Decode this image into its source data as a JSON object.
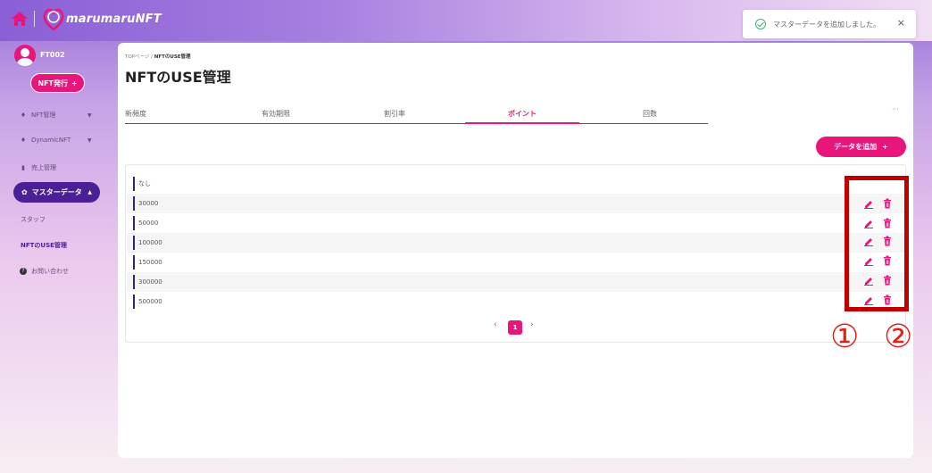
{
  "app": {
    "logo_text": "marumaruNFT"
  },
  "toast": {
    "message": "マスターデータを追加しました。",
    "close": "×"
  },
  "user": {
    "name": "FT002"
  },
  "sidebar": {
    "issue_button": "NFT発行",
    "issue_plus": "+",
    "items": [
      {
        "label": "NFT管理",
        "icon": "♦",
        "chevron": "▼"
      },
      {
        "label": "DynamicNFT",
        "icon": "♦",
        "chevron": "▼"
      },
      {
        "label": "売上管理",
        "icon": "▮"
      },
      {
        "label": "マスターデータ",
        "icon": "✿",
        "chevron": "▲"
      },
      {
        "label": "スタッフ"
      },
      {
        "label": "NFTのUSE管理"
      },
      {
        "label": "お問い合わせ",
        "icon": "?"
      }
    ]
  },
  "breadcrumb": {
    "home": "TOPページ",
    "sep": "/",
    "current": "NFTのUSE管理"
  },
  "page": {
    "title": "NFTのUSE管理"
  },
  "tabs": {
    "items": [
      "新頻度",
      "有効期限",
      "割引率",
      "ポイント",
      "回数"
    ],
    "active": "ポイント",
    "more": "···"
  },
  "add_button": {
    "label": "データを追加",
    "plus": "+"
  },
  "rows": [
    "なし",
    "30000",
    "50000",
    "100000",
    "150000",
    "300000",
    "500000"
  ],
  "pagination": {
    "prev": "‹",
    "current": "1",
    "next": "›"
  },
  "callouts": [
    "①",
    "②"
  ],
  "colors": {
    "accent": "#e8157a",
    "nav_active": "#4b1f96",
    "highlight": "#c00000"
  },
  "icons": {
    "edit": "pencil-icon",
    "delete": "trash-icon"
  }
}
